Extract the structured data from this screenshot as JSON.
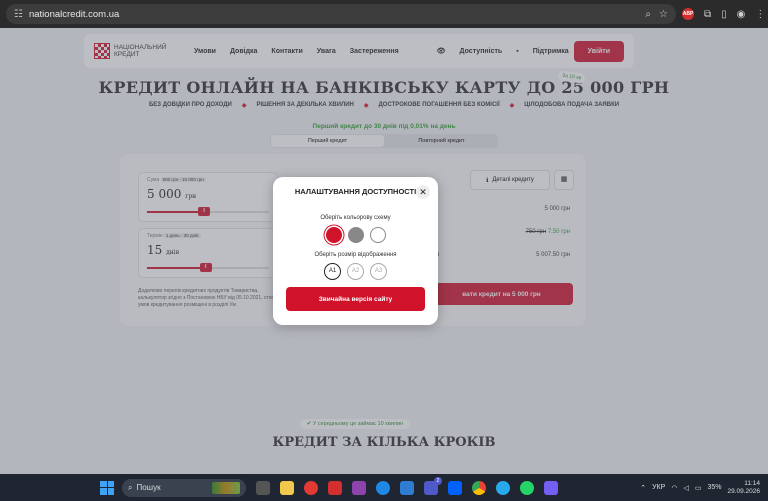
{
  "browser": {
    "url": "nationalcredit.com.ua",
    "icons": [
      "tune-icon",
      "zoom-icon",
      "star-icon",
      "abp-icon",
      "extensions-icon",
      "sidebar-icon",
      "profile-icon",
      "more-icon"
    ],
    "abp_label": "ABP"
  },
  "header": {
    "logo_text": "НАЦІОНАЛЬНИЙ КРЕДИТ",
    "menu": [
      "Умови",
      "Довідка",
      "Контакти",
      "Увага",
      "Застереження"
    ],
    "accessibility": "Доступність",
    "support": "Підтримка",
    "login": "Увійти"
  },
  "hero": {
    "title": "КРЕДИТ ОНЛАЙН НА БАНКІВСЬКУ КАРТУ ДО 25 000 ГРН",
    "badge": "За 10 хв",
    "features": [
      "БЕЗ ДОВІДКИ ПРО ДОХОДИ",
      "РІШЕННЯ ЗА ДЕКІЛЬКА ХВИЛИН",
      "ДОСТРОКОВЕ ПОГАШЕННЯ БЕЗ КОМІСІЇ",
      "ЦІЛОДОБОВА ПОДАЧА ЗАЯВКИ"
    ],
    "promo": "Перший кредит до 30 днів під 0,01% на день",
    "tabs": [
      "Перший кредит",
      "Повторний кредит"
    ]
  },
  "calculator": {
    "sum_label": "Сума",
    "sum_range": "500 грн - 10 000 грн",
    "sum_value": "5 000",
    "sum_unit": "грн",
    "term_label": "Термін",
    "term_range": "1 день - 30 днів",
    "term_value": "15",
    "term_unit": "днів",
    "sum_fill": 0.47,
    "term_fill": 0.48,
    "details": "Деталі кредиту",
    "row1": "5 000 грн",
    "row2_old": "750 грн",
    "row2_new": "7.50 грн",
    "row2_label": "іж",
    "row3_label": "ення",
    "row3": "5 007.50 грн",
    "cta": "вати кредит на 5 000 грн",
    "disclaimer": "Додатково перелік кредитних продуктів Товариства, калькулятор згідно з Постановою НБУ від 05.10.2021, стосовно умов кредитування розміщені в розділі Ум"
  },
  "steps": {
    "badge": "У середньому це займає 10 хвилин",
    "title": "КРЕДИТ ЗА КІЛЬКА КРОКІВ"
  },
  "modal": {
    "title": "НАЛАШТУВАННЯ ДОСТУПНОСТІ",
    "color_label": "Оберіть кольорову схему",
    "colors": [
      "#d0122b",
      "#888888",
      "#ffffff"
    ],
    "size_label": "Оберіть розмір відображення",
    "sizes": [
      "A1",
      "A2",
      "A3"
    ],
    "button": "Звичайна версія сайту"
  },
  "taskbar": {
    "search": "Пошук",
    "lang": "УКР",
    "battery": "35%",
    "time": "11:14",
    "date": "29.09.2026",
    "badge_count": "2"
  }
}
